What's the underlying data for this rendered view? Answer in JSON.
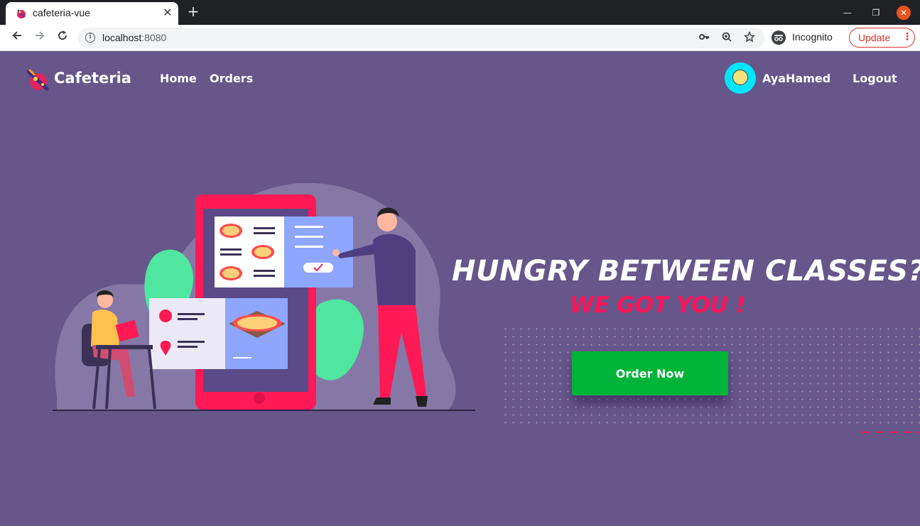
{
  "browser": {
    "tab_title": "cafeteria-vue",
    "tab_close": "✕",
    "new_tab": "+",
    "url_host": "localhost",
    "url_port": ":8080",
    "incognito_label": "Incognito",
    "update_label": "Update",
    "update_menu": "⋮",
    "window_min": "—",
    "window_max": "❐",
    "window_close": "✕",
    "icons": [
      "back-icon",
      "forward-icon",
      "reload-icon",
      "info-icon",
      "key-icon",
      "zoom-icon",
      "star-icon",
      "incognito-icon"
    ]
  },
  "navbar": {
    "brand": "Cafeteria",
    "links": [
      "Home",
      "Orders"
    ],
    "user_name": "AyaHamed",
    "logout": "Logout"
  },
  "hero": {
    "headline": "HUNGRY BETWEEN CLASSES?",
    "subline": "WE GOT YOU !",
    "cta": "Order Now"
  },
  "colors": {
    "page_bg": "#66568a",
    "accent_pink": "#ff1458",
    "cta_green": "#00b43a",
    "avatar_bg": "#00e5ff",
    "update_red": "#d93025"
  }
}
